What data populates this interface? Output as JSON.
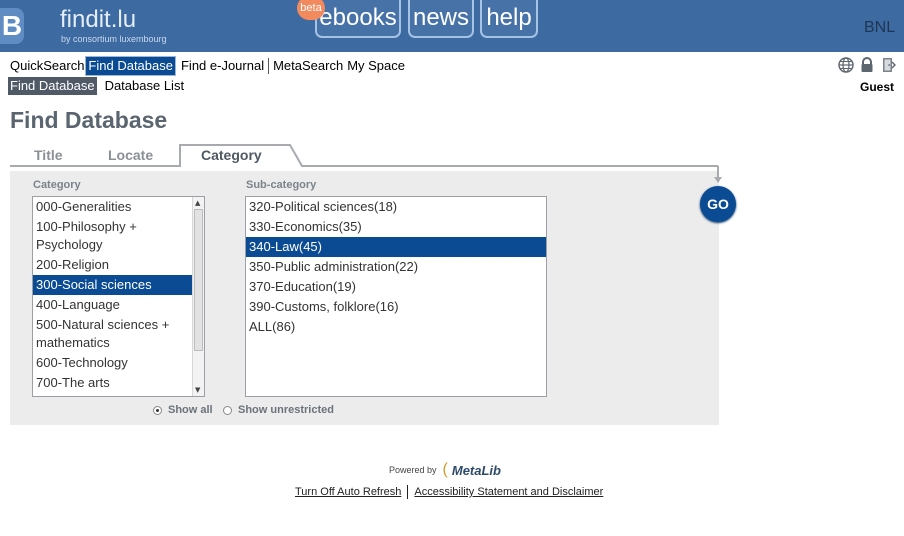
{
  "header": {
    "logo_letter": "B",
    "brand": "findit.lu",
    "brand_subtitle": "by consortium luxembourg",
    "badge": "beta",
    "top_tabs": [
      "ebooks",
      "news",
      "help"
    ],
    "institution": "BNL"
  },
  "nav": {
    "items": [
      "QuickSearch",
      "Find Database",
      "Find e-Journal",
      "MetaSearch",
      "My Space"
    ],
    "active": "Find Database"
  },
  "subnav": {
    "items": [
      "Find Database",
      "Database List"
    ],
    "active": "Find Database"
  },
  "user": {
    "name": "Guest"
  },
  "utility_icons": [
    "globe-icon",
    "lock-icon",
    "exit-door-icon"
  ],
  "page": {
    "title": "Find Database",
    "tabs": [
      "Title",
      "Locate",
      "Category"
    ],
    "active_tab": "Category"
  },
  "form": {
    "category_label": "Category",
    "subcategory_label": "Sub-category",
    "categories": [
      "000-Generalities",
      "100-Philosophy + Psychology",
      "200-Religion",
      "300-Social sciences",
      "400-Language",
      "500-Natural sciences + mathematics",
      "600-Technology",
      "700-The arts"
    ],
    "selected_category": "300-Social sciences",
    "subcategories": [
      "320-Political sciences(18)",
      "330-Economics(35)",
      "340-Law(45)",
      "350-Public administration(22)",
      "370-Education(19)",
      "390-Customs, folklore(16)",
      "ALL(86)"
    ],
    "selected_subcategory": "340-Law(45)",
    "go_label": "GO",
    "radio_show_all": "Show all",
    "radio_show_unrestricted": "Show unrestricted",
    "radio_selected": "Show all"
  },
  "footer": {
    "powered_by": "Powered by",
    "metalib": "MetaLib",
    "links": [
      "Turn Off Auto Refresh",
      "Accessibility Statement and Disclaimer"
    ]
  },
  "colors": {
    "header_bg": "#3d6aa0",
    "selection": "#0b4b93",
    "panel_bg": "#ececec"
  }
}
